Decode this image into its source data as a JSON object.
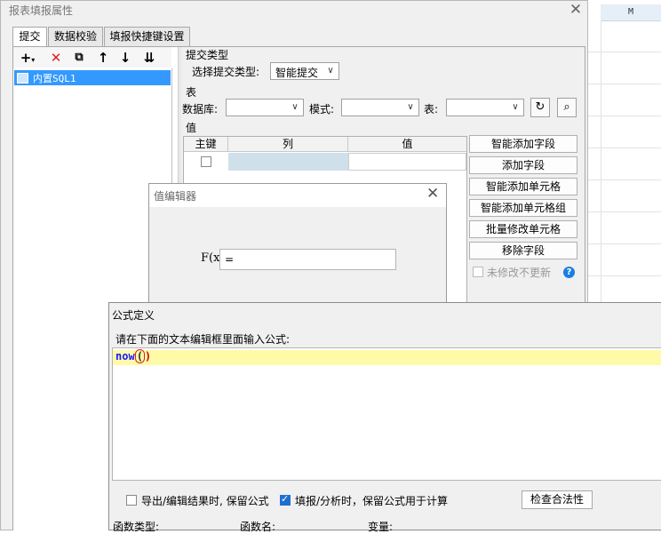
{
  "spreadsheet": {
    "column_header": "M"
  },
  "dialog": {
    "title": "报表填报属性",
    "tabs": [
      {
        "label": "提交"
      },
      {
        "label": "数据校验"
      },
      {
        "label": "填报快捷键设置"
      }
    ],
    "tree": {
      "items": [
        {
          "label": "内置SQL1"
        }
      ]
    },
    "submit_type": {
      "section_label": "提交类型",
      "select_label": "选择提交类型:",
      "select_value": "智能提交"
    },
    "table_section": {
      "section_label": "表",
      "database_label": "数据库:",
      "schema_label": "模式:",
      "table_label": "表:"
    },
    "value_section": {
      "section_label": "值",
      "columns": [
        "主键",
        "列",
        "值"
      ]
    },
    "buttons": [
      "智能添加字段",
      "添加字段",
      "智能添加单元格",
      "智能添加单元格组",
      "批量修改单元格",
      "移除字段"
    ],
    "unmodified_label": "未修改不更新"
  },
  "value_editor": {
    "title": "值编辑器",
    "fx_label": "F(x)",
    "input_value": "="
  },
  "formula_dialog": {
    "title": "公式定义",
    "prompt": "请在下面的文本编辑框里面输入公式:",
    "formula_fn": "now",
    "formula_open": "(",
    "formula_close": ")",
    "option_export": "导出/编辑结果时, 保留公式",
    "option_fill": "填报/分析时，保留公式用于计算",
    "check_button": "检查合法性",
    "footer_labels": [
      "函数类型:",
      "函数名:",
      "变量:"
    ]
  }
}
